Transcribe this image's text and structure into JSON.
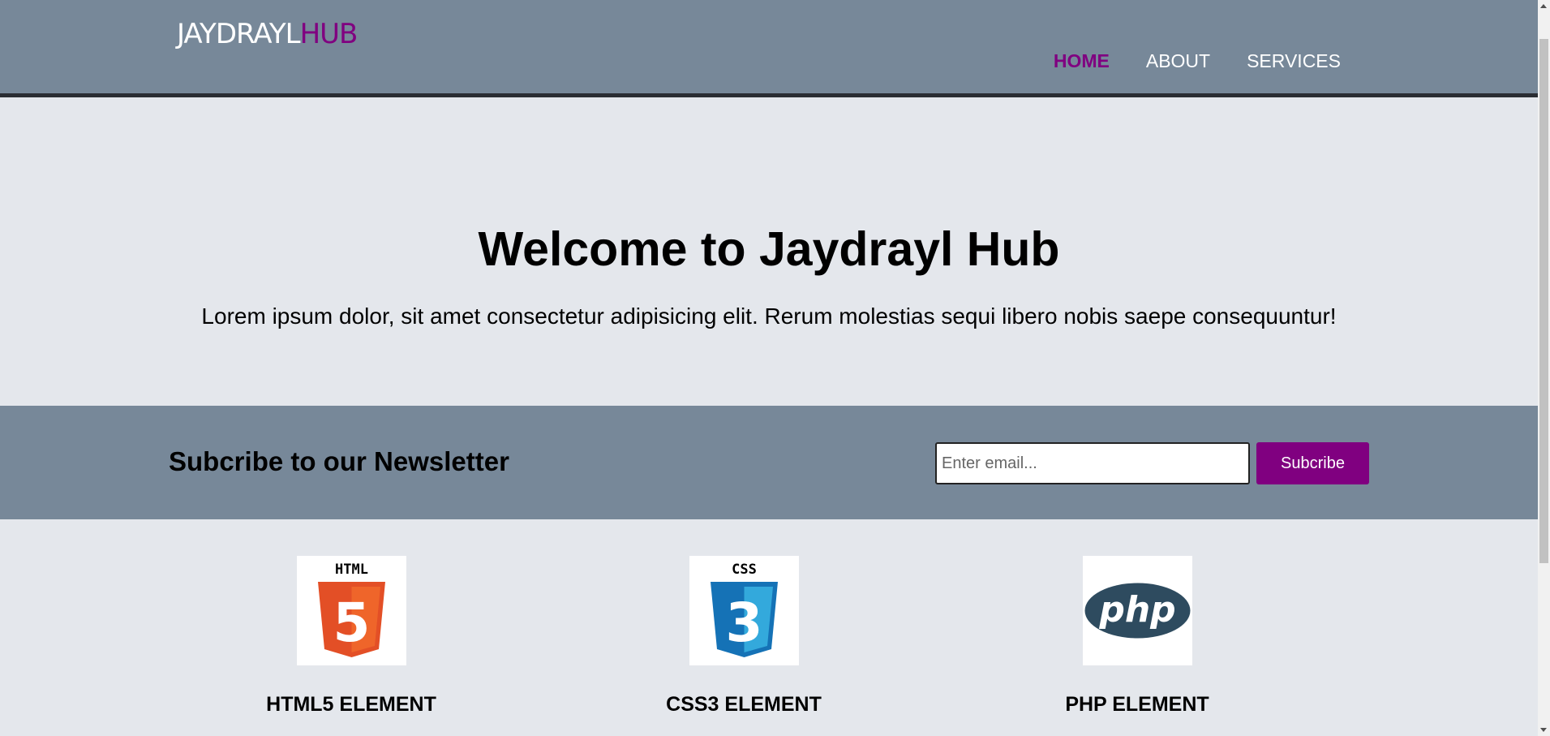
{
  "header": {
    "logo_white": "JAYDRAYL",
    "logo_purple": "HUB",
    "nav": [
      {
        "label": "HOME",
        "active": true
      },
      {
        "label": "ABOUT",
        "active": false
      },
      {
        "label": "SERVICES",
        "active": false
      }
    ]
  },
  "hero": {
    "title": "Welcome to Jaydrayl Hub",
    "text": "Lorem ipsum dolor, sit amet consectetur adipisicing elit. Rerum molestias sequi libero nobis saepe consequuntur!"
  },
  "newsletter": {
    "heading": "Subcribe to our Newsletter",
    "email_placeholder": "Enter email...",
    "email_value": "",
    "button_label": "Subcribe"
  },
  "boxes": [
    {
      "icon": "html5-logo-icon",
      "badge": "HTML",
      "numeral": "5",
      "title": "HTML5 ELEMENT"
    },
    {
      "icon": "css3-logo-icon",
      "badge": "CSS",
      "numeral": "3",
      "title": "CSS3 ELEMENT"
    },
    {
      "icon": "php-logo-icon",
      "badge": "php",
      "title": "PHP ELEMENT"
    }
  ],
  "colors": {
    "header_bg": "#778899",
    "accent": "#800080",
    "page_bg": "#e4e7ec",
    "header_border": "#2a2d33"
  }
}
